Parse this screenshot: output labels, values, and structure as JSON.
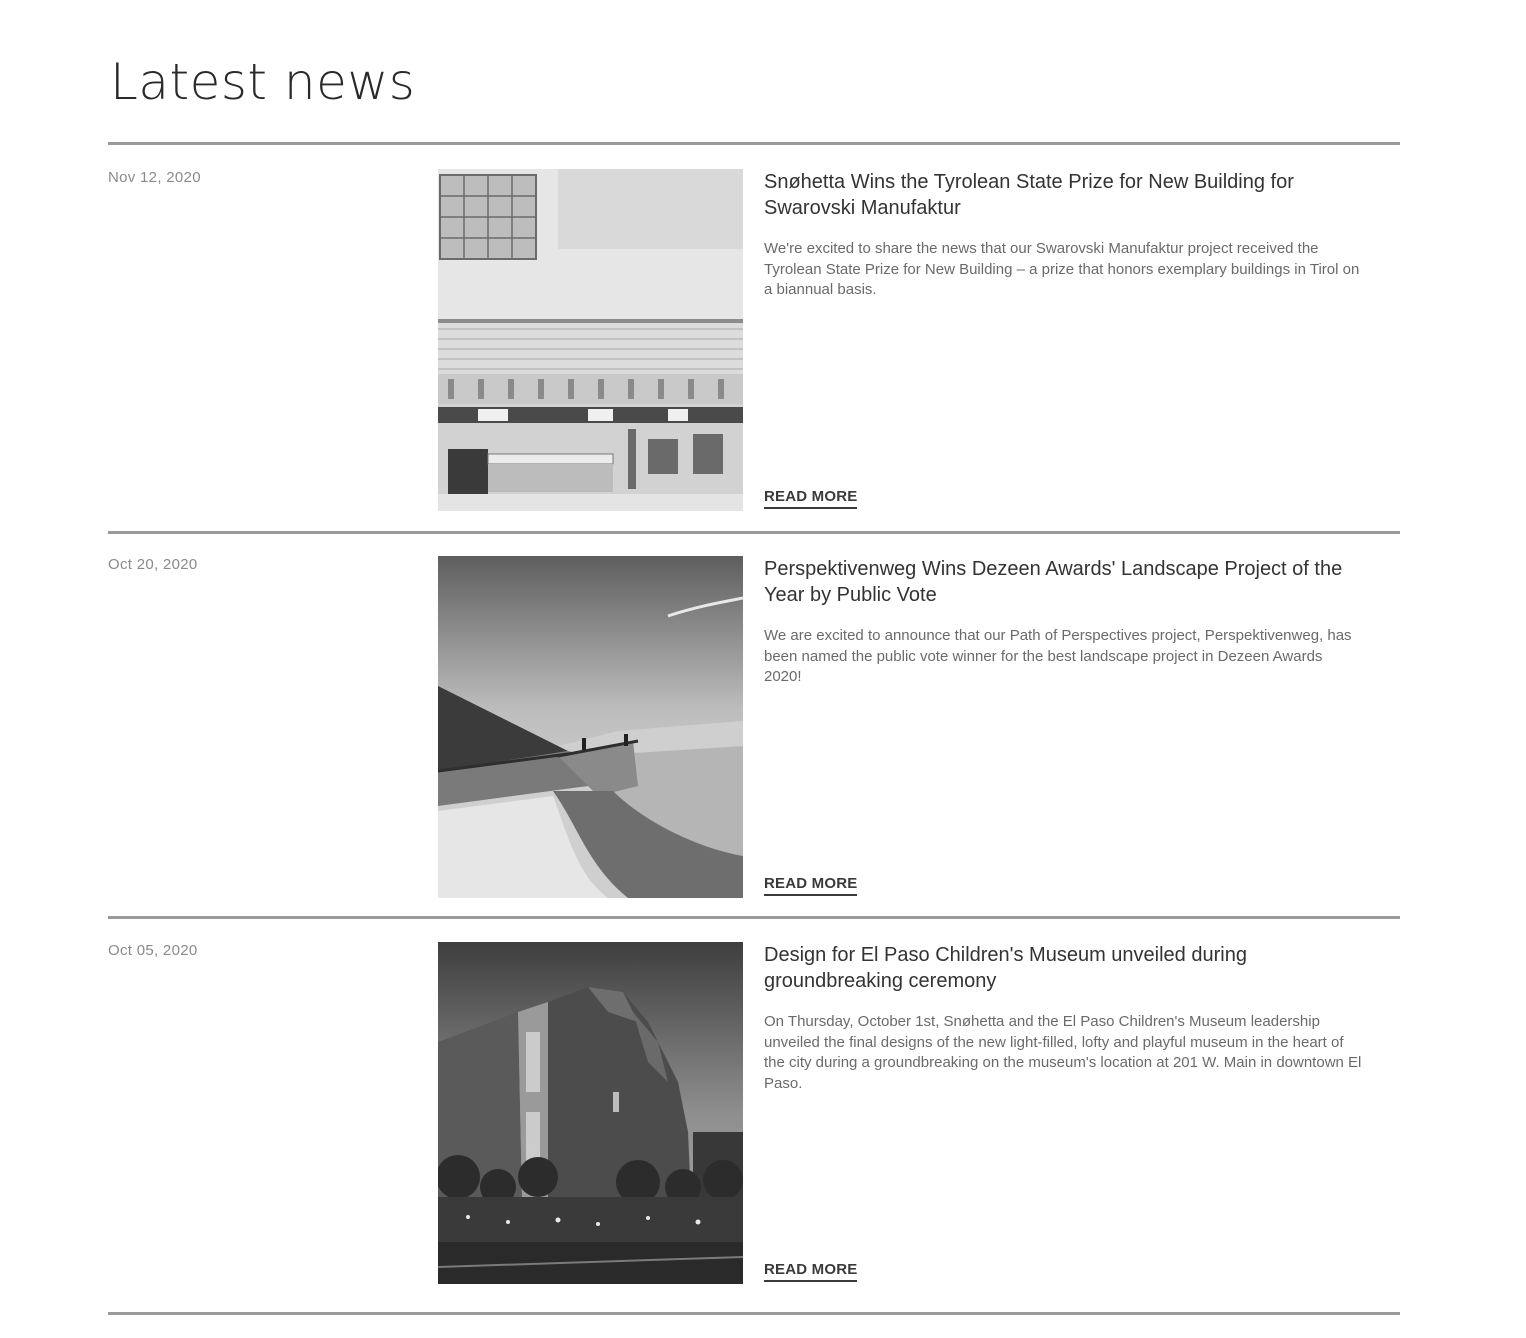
{
  "section": {
    "title": "Latest news"
  },
  "news": [
    {
      "date": "Nov 12, 2020",
      "headline": "Snøhetta Wins the Tyrolean State Prize for New Building for Swarovski Manufaktur",
      "excerpt": "We're excited to share the news that our Swarovski Manufaktur project received the Tyrolean State Prize for New Building – a prize that honors exemplary buildings in Tirol on a biannual basis.",
      "read_more": "READ MORE",
      "image_icon": "architecture-interior-photo"
    },
    {
      "date": "Oct 20, 2020",
      "headline": "Perspektivenweg Wins Dezeen Awards' Landscape Project of the Year by Public Vote",
      "excerpt": "We are excited to announce that our Path of Perspectives project, Perspektivenweg, has been named the public vote winner for the best landscape project in Dezeen Awards 2020!",
      "read_more": "READ MORE",
      "image_icon": "landscape-path-photo"
    },
    {
      "date": "Oct 05, 2020",
      "headline": "Design for El Paso Children's Museum unveiled during groundbreaking ceremony",
      "excerpt": "On Thursday, October 1st, Snøhetta and the El Paso Children's Museum leadership unveiled the final designs of the new light-filled, lofty and playful museum in the heart of the city during a groundbreaking on the museum's location at 201 W. Main in downtown El Paso.",
      "read_more": "READ MORE",
      "image_icon": "museum-exterior-photo"
    }
  ]
}
